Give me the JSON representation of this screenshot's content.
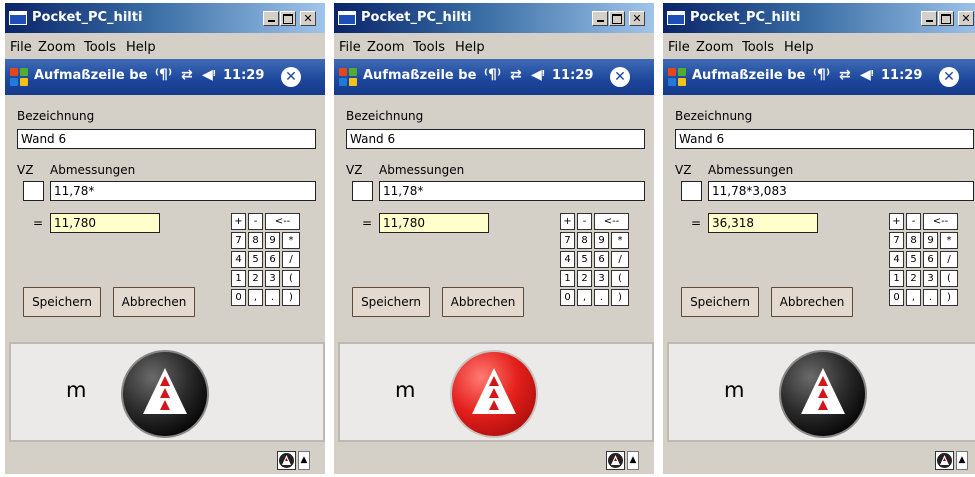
{
  "window": {
    "title": "Pocket_PC_hilti",
    "menu": [
      "File",
      "Zoom",
      "Tools",
      "Help"
    ]
  },
  "nav": {
    "title": "Aufmaßzeile be",
    "time": "11:29"
  },
  "form": {
    "bezeichnung_label": "Bezeichnung",
    "vz_label": "VZ",
    "abmessungen_label": "Abmessungen",
    "equals_label": "=",
    "save_label": "Speichern",
    "cancel_label": "Abbrechen",
    "unit": "m"
  },
  "keypad": [
    [
      "+",
      "-",
      "<--"
    ],
    [
      "7",
      "8",
      "9",
      "*"
    ],
    [
      "4",
      "5",
      "6",
      "/"
    ],
    [
      "1",
      "2",
      "3",
      "("
    ],
    [
      "0",
      ",",
      ".",
      ")"
    ]
  ],
  "screens": [
    {
      "bezeichnung": "Wand 6",
      "vz": "",
      "abmessungen": "11,78*",
      "result": "11,780",
      "logo_state": "dark"
    },
    {
      "bezeichnung": "Wand 6",
      "vz": "",
      "abmessungen": "11,78*",
      "result": "11,780",
      "logo_state": "red"
    },
    {
      "bezeichnung": "Wand 6",
      "vz": "",
      "abmessungen": "11,78*3,083",
      "result": "36,318",
      "logo_state": "dark"
    }
  ],
  "colors": {
    "result_bg": "#ffffcc",
    "nav_bg": "#1c469b",
    "logo_red": "#e4201c",
    "logo_dark": "#1a1a1a"
  },
  "icons": {
    "nav": [
      "windows-start-icon",
      "antenna-icon",
      "sync-arrows-icon",
      "speaker-icon",
      "ok-close-icon"
    ],
    "logo": "hilti-triangle-icon",
    "tray": "tray-app-icon"
  }
}
